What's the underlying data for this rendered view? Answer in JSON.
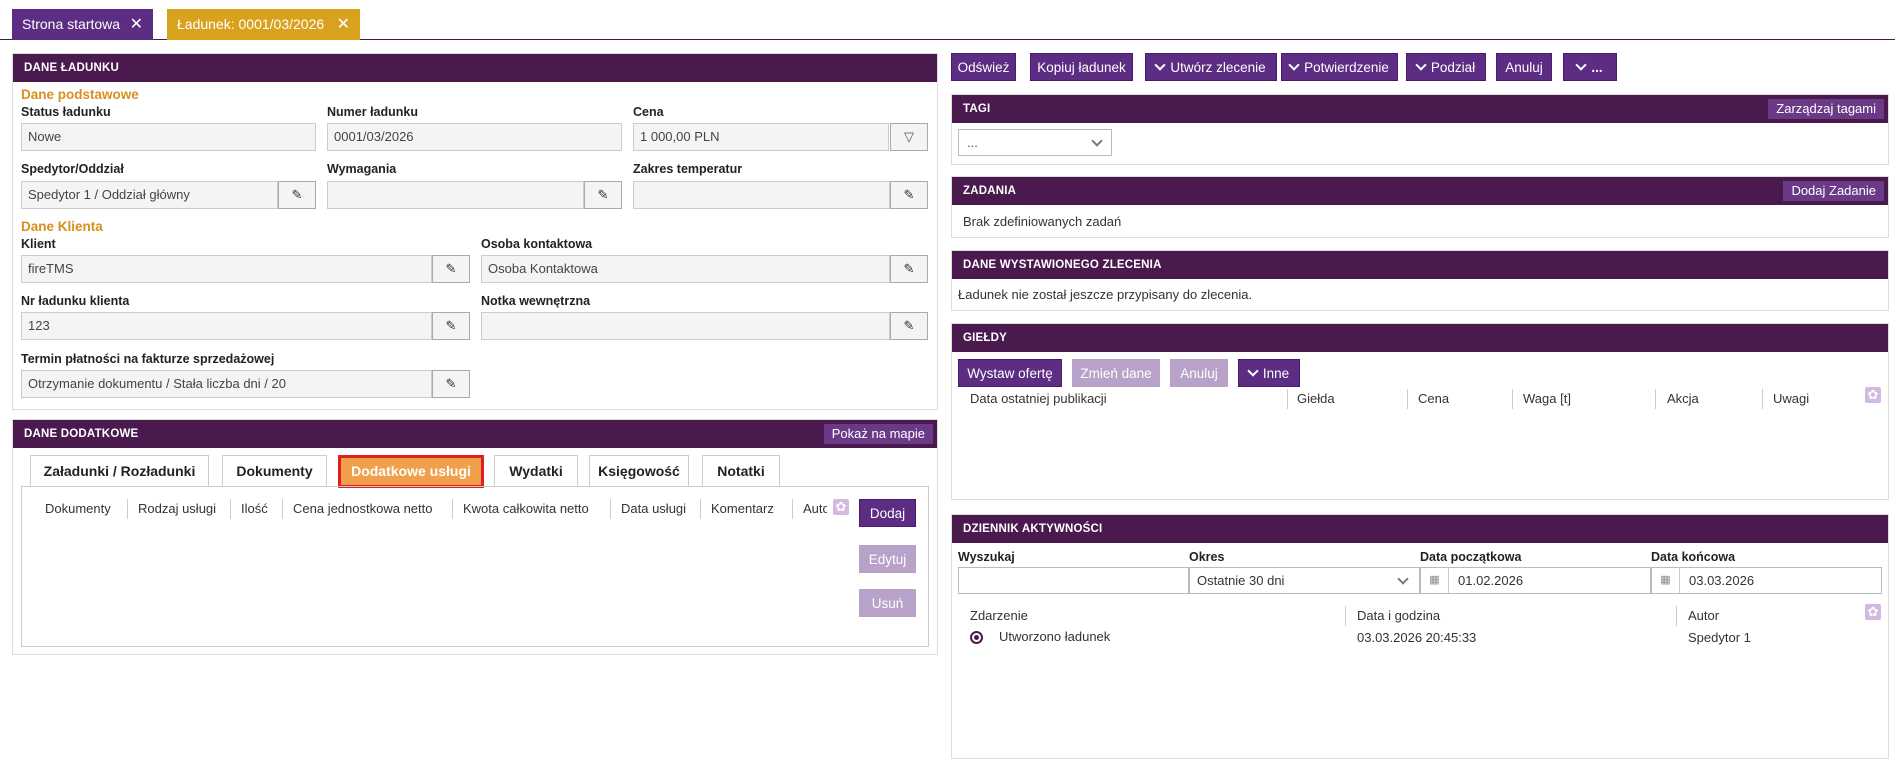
{
  "tabs": [
    {
      "label": "Strona startowa",
      "color": "#5c2d82"
    },
    {
      "label": "Ładunek: 0001/03/2026",
      "color": "#d9a21e"
    }
  ],
  "dane_ladunku": {
    "title": "DANE ŁADUNKU",
    "basic_section": "Dane podstawowe",
    "status_label": "Status ładunku",
    "status_value": "Nowe",
    "numer_label": "Numer ładunku",
    "numer_value": "0001/03/2026",
    "cena_label": "Cena",
    "cena_value": "1 000,00 PLN",
    "spedytor_label": "Spedytor/Oddział",
    "spedytor_value": "Spedytor 1 / Oddział główny",
    "wymagania_label": "Wymagania",
    "wymagania_value": "",
    "zakres_label": "Zakres temperatur",
    "zakres_value": "",
    "client_section": "Dane Klienta",
    "klient_label": "Klient",
    "klient_value": "fireTMS",
    "osoba_label": "Osoba kontaktowa",
    "osoba_value": "Osoba Kontaktowa",
    "nr_label": "Nr ładunku klienta",
    "nr_value": "123",
    "notka_label": "Notka wewnętrzna",
    "notka_value": "",
    "termin_label": "Termin płatności na fakturze sprzedażowej",
    "termin_value": "Otrzymanie dokumentu / Stała liczba dni / 20"
  },
  "dane_dodatkowe": {
    "title": "DANE DODATKOWE",
    "map_button": "Pokaż na mapie",
    "tabs": [
      "Załadunki / Rozładunki",
      "Dokumenty",
      "Dodatkowe usługi",
      "Wydatki",
      "Księgowość",
      "Notatki"
    ],
    "active_tab": "Dodatkowe usługi",
    "columns": [
      "Dokumenty",
      "Rodzaj usługi",
      "Ilość",
      "Cena jednostkowa netto",
      "Kwota całkowita netto",
      "Data usługi",
      "Komentarz",
      "Autor"
    ],
    "buttons": {
      "add": "Dodaj",
      "edit": "Edytuj",
      "delete": "Usuń"
    }
  },
  "toolbar": {
    "refresh": "Odśwież",
    "copy": "Kopiuj ładunek",
    "create_order": "Utwórz zlecenie",
    "confirm": "Potwierdzenie",
    "split": "Podział",
    "cancel": "Anuluj",
    "more": "..."
  },
  "tagi": {
    "title": "TAGI",
    "manage": "Zarządzaj tagami",
    "select_value": "..."
  },
  "zadania": {
    "title": "ZADANIA",
    "add": "Dodaj Zadanie",
    "empty": "Brak zdefiniowanych zadań"
  },
  "zlecenie": {
    "title": "DANE WYSTAWIONEGO ZLECENIA",
    "text": "Ładunek nie został jeszcze przypisany do zlecenia."
  },
  "gieldy": {
    "title": "GIEŁDY",
    "buttons": {
      "offer": "Wystaw ofertę",
      "change": "Zmień dane",
      "cancel": "Anuluj",
      "other": "Inne"
    },
    "columns": [
      "Data ostatniej publikacji",
      "Giełda",
      "Cena",
      "Waga [t]",
      "Akcja",
      "Uwagi"
    ]
  },
  "dziennik": {
    "title": "DZIENNIK AKTYWNOŚCI",
    "search_label": "Wyszukaj",
    "okres_label": "Okres",
    "okres_value": "Ostatnie 30 dni",
    "start_label": "Data początkowa",
    "start_value": "01.02.2026",
    "end_label": "Data końcowa",
    "end_value": "03.03.2026",
    "columns": [
      "Zdarzenie",
      "Data i godzina",
      "Autor"
    ],
    "rows": [
      {
        "event": "Utworzono ładunek",
        "datetime": "03.03.2026 20:45:33",
        "author": "Spedytor 1"
      }
    ]
  }
}
